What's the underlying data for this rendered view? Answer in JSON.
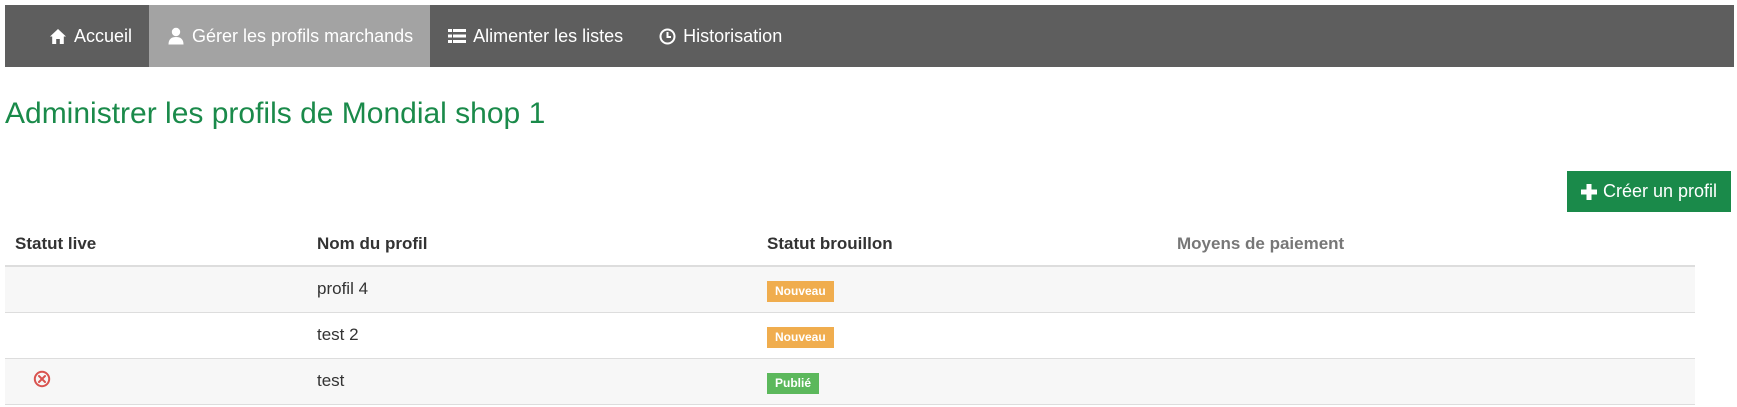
{
  "nav": {
    "items": [
      {
        "label": "Accueil",
        "icon": "home-icon"
      },
      {
        "label": "Gérer les profils marchands",
        "icon": "user-icon"
      },
      {
        "label": "Alimenter les listes",
        "icon": "list-icon"
      },
      {
        "label": "Historisation",
        "icon": "clock-icon"
      }
    ],
    "active_index": 1
  },
  "page": {
    "title": "Administrer les profils de Mondial shop 1",
    "create_button_label": "Créer un profil"
  },
  "table": {
    "headers": [
      "Statut live",
      "Nom du profil",
      "Statut brouillon",
      "Moyens de paiement"
    ],
    "rows": [
      {
        "live_status_icon": "",
        "name": "profil 4",
        "draft_status": "Nouveau",
        "draft_status_color": "#f0ad4e",
        "payment": ""
      },
      {
        "live_status_icon": "",
        "name": "test 2",
        "draft_status": "Nouveau",
        "draft_status_color": "#f0ad4e",
        "payment": ""
      },
      {
        "live_status_icon": "circle-x-icon",
        "name": "test",
        "draft_status": "Publié",
        "draft_status_color": "#5cb85c",
        "payment": ""
      }
    ]
  },
  "colors": {
    "navbar_bg": "#5e5e5e",
    "navbar_active_bg": "#a3a3a3",
    "brand_green": "#1a8a4a",
    "danger_red": "#d9534f"
  }
}
